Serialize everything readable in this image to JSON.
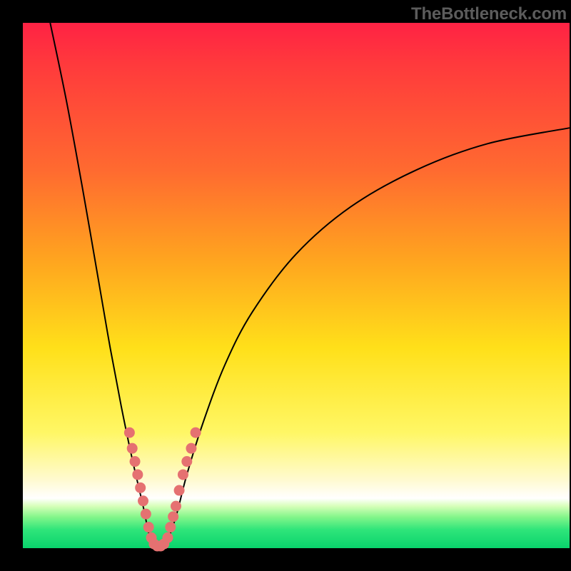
{
  "attribution": "TheBottleneck.com",
  "colors": {
    "gradient_top": "#ff2244",
    "gradient_mid_orange": "#ffa41f",
    "gradient_mid_yellow": "#ffe01a",
    "gradient_light": "#fffad0",
    "gradient_green": "#09d36c",
    "accent_dot": "#e57171",
    "curve": "#000000",
    "frame": "#000000"
  },
  "chart_data": {
    "type": "line",
    "title": "",
    "xlabel": "",
    "ylabel": "",
    "xlim": [
      0,
      100
    ],
    "ylim": [
      0,
      100
    ],
    "grid": false,
    "legend": false,
    "series": [
      {
        "name": "left-arm",
        "comment": "Steep descending curve from upper-left to valley near x≈24",
        "x": [
          5,
          8,
          11,
          14,
          16,
          18,
          20,
          22,
          23,
          24
        ],
        "y": [
          100,
          85,
          68,
          50,
          38,
          27,
          17,
          8,
          3,
          0
        ]
      },
      {
        "name": "right-arm",
        "comment": "Curve rising from valley near x≈26, flattening toward right edge (~y≈80)",
        "x": [
          26,
          28,
          30,
          33,
          37,
          42,
          50,
          60,
          72,
          85,
          100
        ],
        "y": [
          0,
          6,
          14,
          24,
          35,
          45,
          56,
          65,
          72,
          77,
          80
        ]
      }
    ],
    "accent_points": {
      "comment": "Salmon/pink dotted segments clustered near the valley on both arms",
      "left_arm": [
        {
          "x": 19.5,
          "y": 22
        },
        {
          "x": 20.0,
          "y": 19
        },
        {
          "x": 20.5,
          "y": 16.5
        },
        {
          "x": 21.0,
          "y": 14
        },
        {
          "x": 21.5,
          "y": 11.5
        },
        {
          "x": 22.0,
          "y": 9
        },
        {
          "x": 22.5,
          "y": 6.5
        },
        {
          "x": 23.0,
          "y": 4
        },
        {
          "x": 23.5,
          "y": 2
        }
      ],
      "right_arm": [
        {
          "x": 26.5,
          "y": 2
        },
        {
          "x": 27.0,
          "y": 4
        },
        {
          "x": 27.5,
          "y": 6
        },
        {
          "x": 28.0,
          "y": 8
        },
        {
          "x": 28.6,
          "y": 11
        },
        {
          "x": 29.3,
          "y": 14
        },
        {
          "x": 30.0,
          "y": 16.5
        },
        {
          "x": 30.8,
          "y": 19
        },
        {
          "x": 31.6,
          "y": 22
        }
      ],
      "valley_floor": [
        {
          "x": 24.0,
          "y": 0.8
        },
        {
          "x": 24.6,
          "y": 0.4
        },
        {
          "x": 25.2,
          "y": 0.4
        },
        {
          "x": 25.8,
          "y": 0.8
        }
      ]
    }
  }
}
